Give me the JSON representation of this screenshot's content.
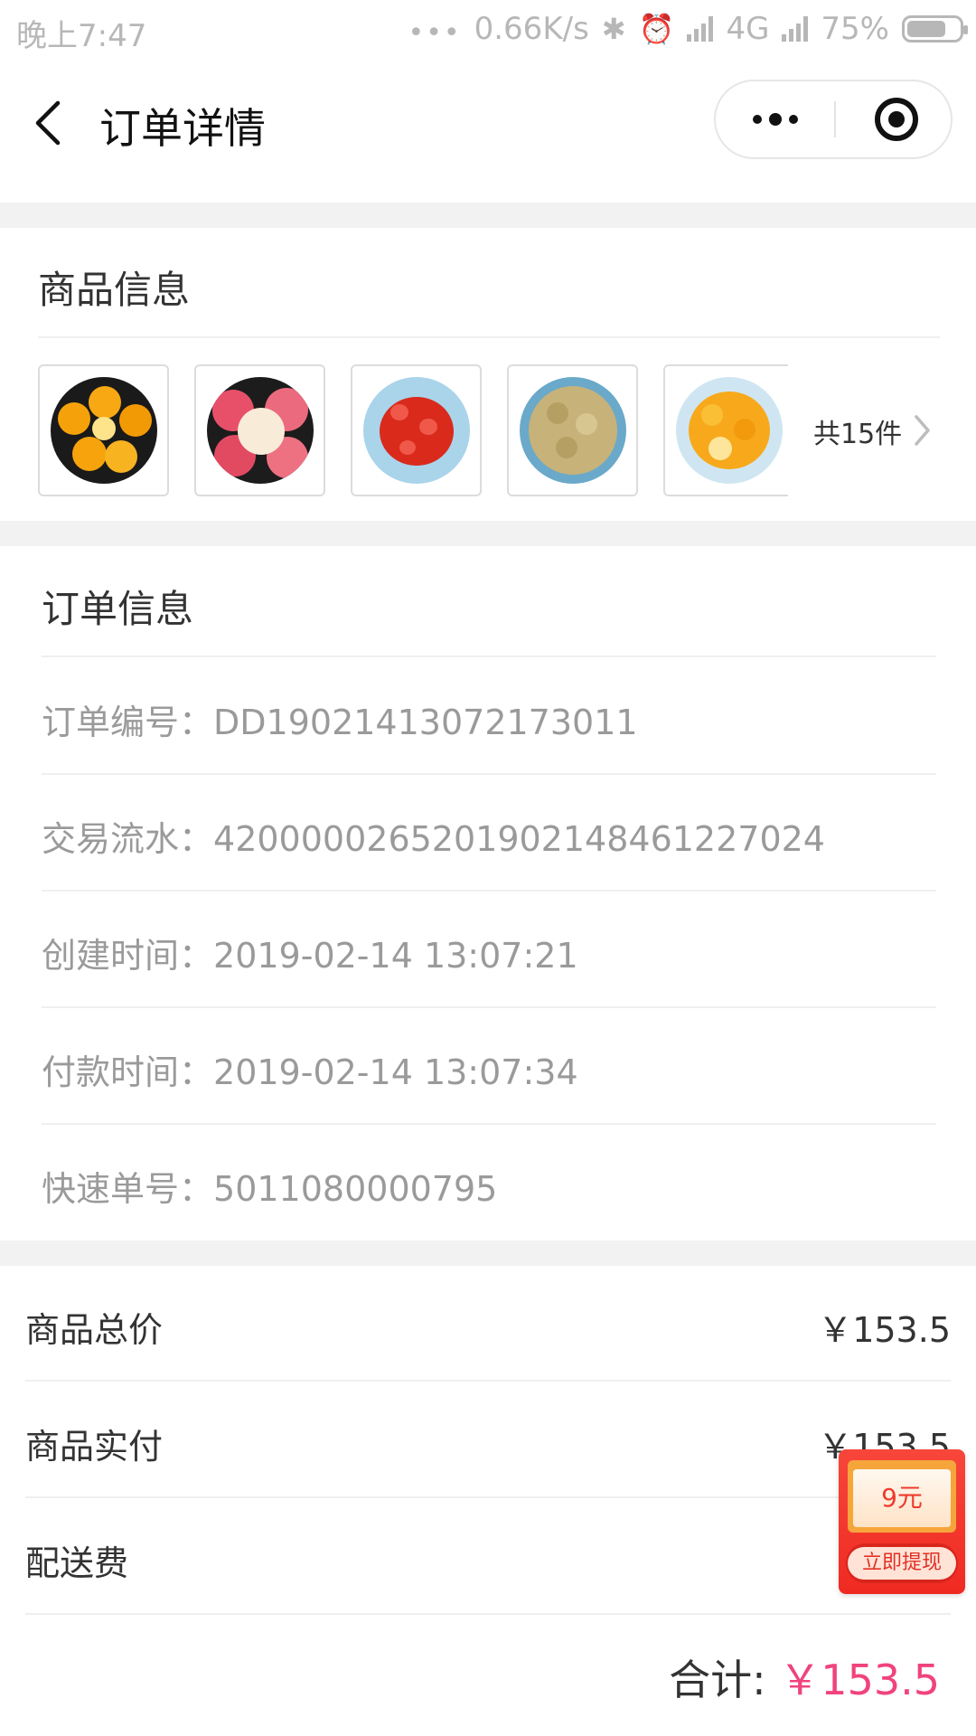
{
  "status_bar": {
    "time": "晚上7:47",
    "dots": "•••",
    "net_speed": "0.66K/s",
    "bluetooth_glyph": "✱",
    "alarm_glyph": "⏰",
    "network": "4G",
    "battery": "75%",
    "battery_level": 0.75
  },
  "nav": {
    "title": "订单详情"
  },
  "goods": {
    "section_title": "商品信息",
    "count_text": "共15件",
    "thumbnails": [
      "orange-plate",
      "apple-plate",
      "cherry-tomato-plate",
      "longan-plate",
      "kumquat-plate"
    ]
  },
  "order": {
    "section_title": "订单信息",
    "rows": [
      {
        "label": "订单编号",
        "value": "DD19021413072173011"
      },
      {
        "label": "交易流水",
        "value": "4200000265201902148461227024"
      },
      {
        "label": "创建时间",
        "value": "2019-02-14 13:07:21"
      },
      {
        "label": "付款时间",
        "value": "2019-02-14 13:07:34"
      },
      {
        "label": "快速单号",
        "value": "5011080000795"
      }
    ]
  },
  "price": {
    "rows": [
      {
        "label": "商品总价",
        "value": "￥153.5"
      },
      {
        "label": "商品实付",
        "value": "￥153.5"
      },
      {
        "label": "配送费",
        "value": ""
      }
    ],
    "total_label": "合计:",
    "total_value": "￥153.5",
    "accent_color": "#f0437c"
  },
  "promo": {
    "amount": "9元",
    "cta": "立即提现"
  }
}
